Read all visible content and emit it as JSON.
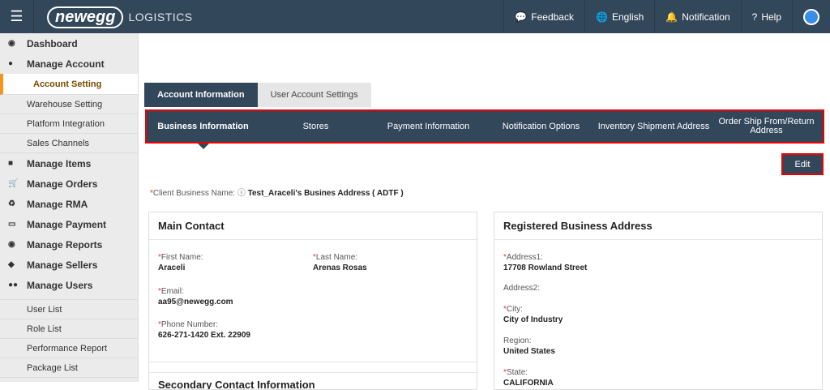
{
  "header": {
    "logo_brand": "newegg",
    "logo_product": "LOGISTICS",
    "nav": [
      "Feedback",
      "English",
      "Notification",
      "Help"
    ]
  },
  "sidebar": {
    "dashboard": "Dashboard",
    "manage_account": "Manage Account",
    "account_subitems": [
      "Account Setting",
      "Warehouse Setting",
      "Platform Integration",
      "Sales Channels"
    ],
    "groups": [
      "Manage Items",
      "Manage Orders",
      "Manage RMA",
      "Manage Payment",
      "Manage Reports",
      "Manage Sellers",
      "Manage Users"
    ],
    "user_subitems": [
      "User List",
      "Role List",
      "Performance Report",
      "Package List"
    ]
  },
  "tabs": [
    "Account Information",
    "User Account Settings"
  ],
  "subnav": [
    "Business Information",
    "Stores",
    "Payment Information",
    "Notification Options",
    "Inventory Shipment Address",
    "Order Ship From/Return Address"
  ],
  "edit_label": "Edit",
  "client_business_name": {
    "label": "Client Business Name:",
    "value": "Test_Araceli's Busines Address ( ADTF )"
  },
  "main_contact": {
    "title": "Main Contact",
    "first_name_label": "First Name:",
    "first_name": "Araceli",
    "last_name_label": "Last Name:",
    "last_name": "Arenas Rosas",
    "email_label": "Email:",
    "email": "aa95@newegg.com",
    "phone_label": "Phone Number:",
    "phone": "626-271-1420 Ext. 22909"
  },
  "secondary_title": "Secondary Contact Information",
  "registered": {
    "title": "Registered Business Address",
    "address1_label": "Address1:",
    "address1": "17708 Rowland Street",
    "address2_label": "Address2:",
    "city_label": "City:",
    "city": "City of Industry",
    "region_label": "Region:",
    "region": "United States",
    "state_label": "State:",
    "state": "CALIFORNIA"
  }
}
